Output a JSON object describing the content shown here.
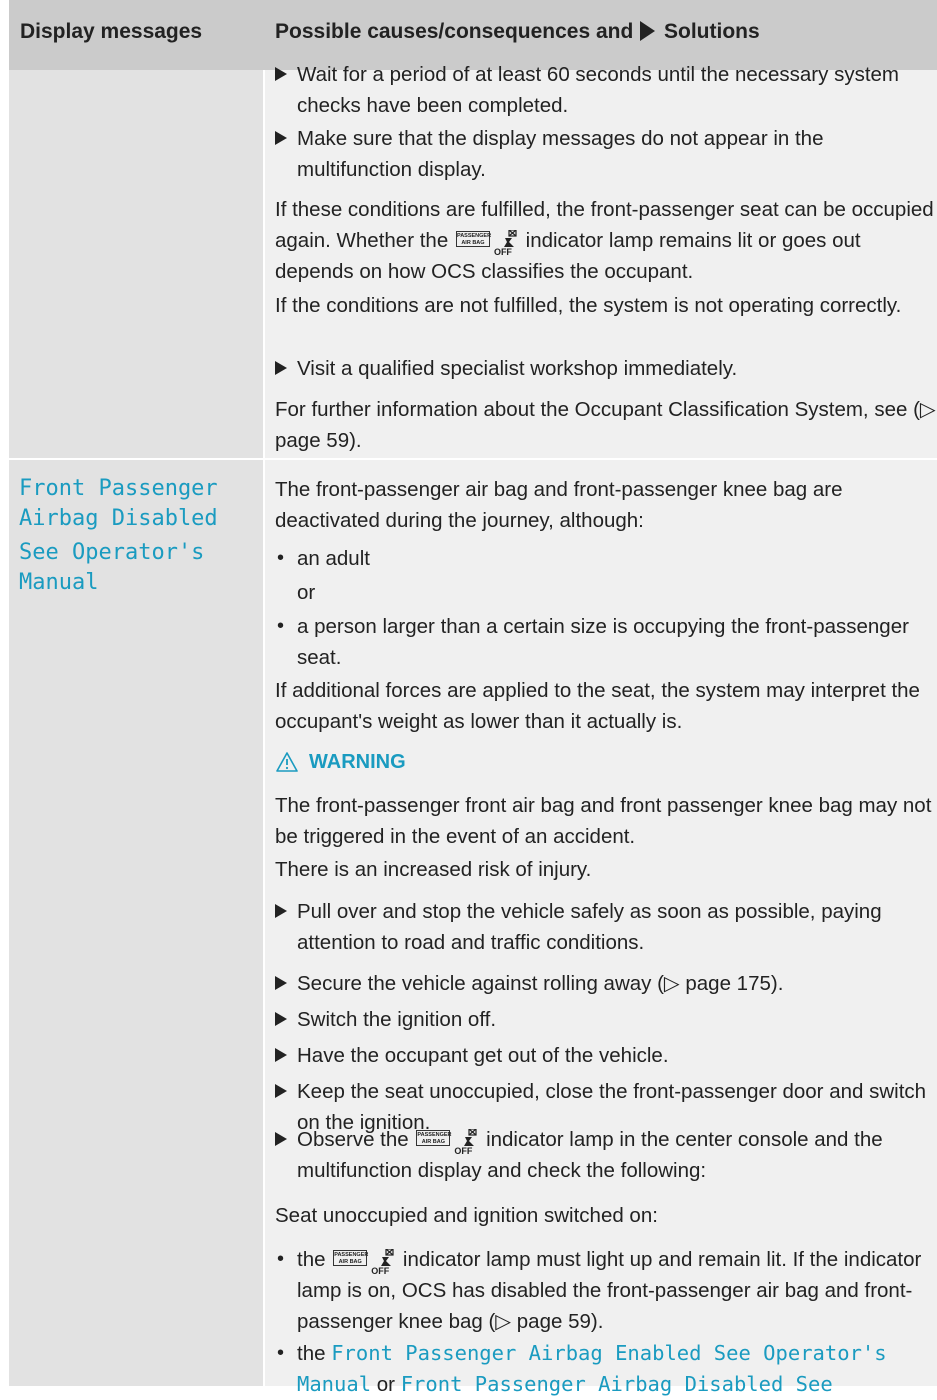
{
  "header": {
    "col1": "Display messages",
    "col2_a": "Possible causes/consequences and",
    "col2_b": "Solutions"
  },
  "indicator": {
    "line1": "PASSENGER",
    "line2": "AIR BAG",
    "off": "OFF"
  },
  "row1": {
    "b1": "Wait for a period of at least 60 seconds until the necessary system checks have been completed.",
    "b2": "Make sure that the display messages do not appear in the multifunction display.",
    "p1a": "If these conditions are fulfilled, the front-passenger seat can be occupied again. Whether the",
    "p1b": "indicator lamp remains lit or goes out depends on how OCS classifies the occupant.",
    "p2": "If the conditions are not fulfilled, the system is not operating correctly.",
    "b3": "Visit a qualified specialist workshop immediately.",
    "p3": "For further information about the Occupant Classification System, see (▷ page 59)."
  },
  "row2": {
    "msg1": "Front Passenger",
    "msg2": "Airbag Disabled",
    "msg3": "See Operator's",
    "msg4": "Manual",
    "intro": "The front-passenger air bag and front-passenger knee bag are deactivated during the journey, although:",
    "d1": "an adult",
    "or": "or",
    "d2": "a person larger than a certain size is occupying the front-passenger seat.",
    "p_forces": "If additional forces are applied to the seat, the system may interpret the occupant's weight as lower than it actually is.",
    "warning": "WARNING",
    "w1": "The front-passenger front air bag and front passenger knee bag may not be triggered in the event of an accident.",
    "w2": "There is an increased risk of injury.",
    "s1": "Pull over and stop the vehicle safely as soon as possible, paying attention to road and traffic conditions.",
    "s2": "Secure the vehicle against rolling away (▷ page 175).",
    "s3": "Switch the ignition off.",
    "s4": "Have the occupant get out of the vehicle.",
    "s5": "Keep the seat unoccupied, close the front-passenger door and switch on the ignition.",
    "s6a": "Observe the",
    "s6b": "indicator lamp in the center console and the multifunction display and check the following:",
    "seat": "Seat unoccupied and ignition switched on:",
    "e1a": "the",
    "e1b": "indicator lamp must light up and remain lit. If the indicator lamp is on, OCS has disabled the front-passenger air bag and front-passenger knee bag (▷ page 59).",
    "e2a": "the",
    "e2m1": "Front Passenger Airbag Enabled See Operator's Manual",
    "e2or": "or",
    "e2m2": "Front Passenger Airbag Disabled See"
  }
}
